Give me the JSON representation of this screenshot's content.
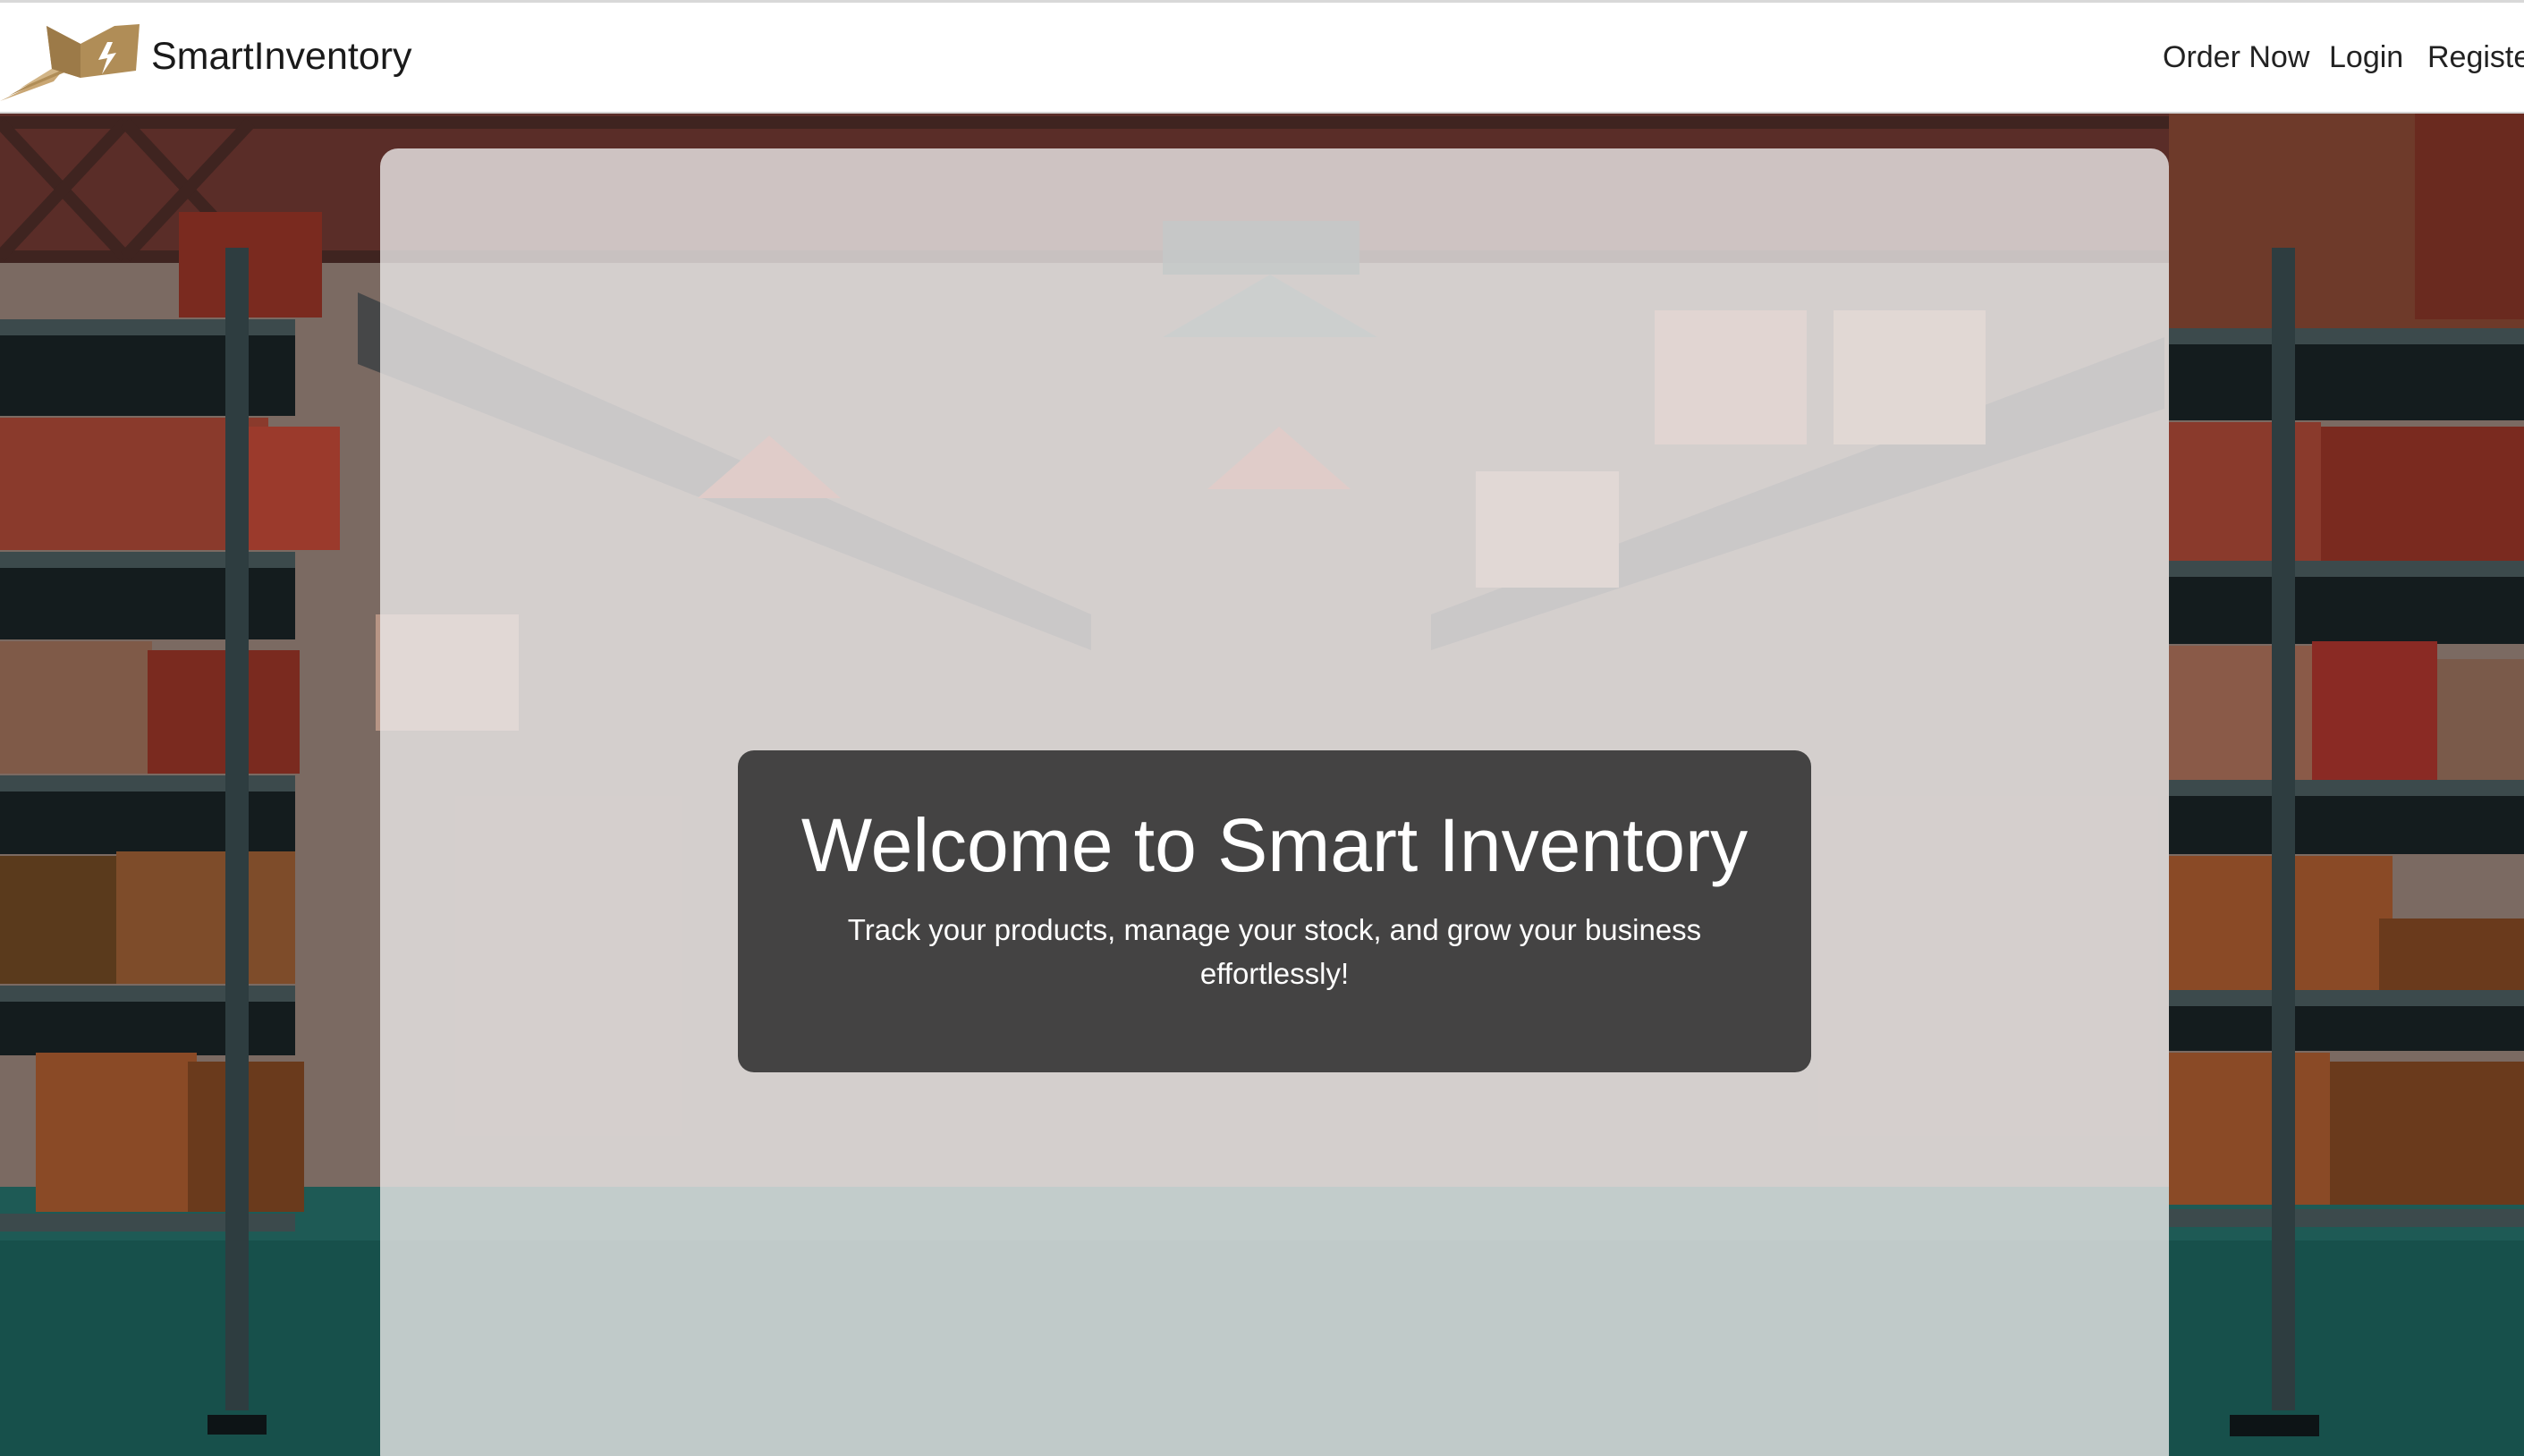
{
  "app": {
    "brand": "SmartInventory",
    "logo_icon": "lightning-box-logo"
  },
  "nav": {
    "links": [
      "Order Now",
      "Login",
      "Registe"
    ]
  },
  "hero": {
    "title": "Welcome to Smart Inventory",
    "subtitle": "Track your products, manage your stock, and grow your business effortlessly!"
  },
  "colors": {
    "navbar_bg": "#ffffff",
    "logo_gold": "#b08d57",
    "shelf_dark": "#1f2a2c",
    "box_red": "#7a2a1f",
    "box_tan": "#b98a5c",
    "floor_teal": "#1e5a55",
    "panel_overlay": "#ebe8e8",
    "welcome_bg": "#303030"
  }
}
